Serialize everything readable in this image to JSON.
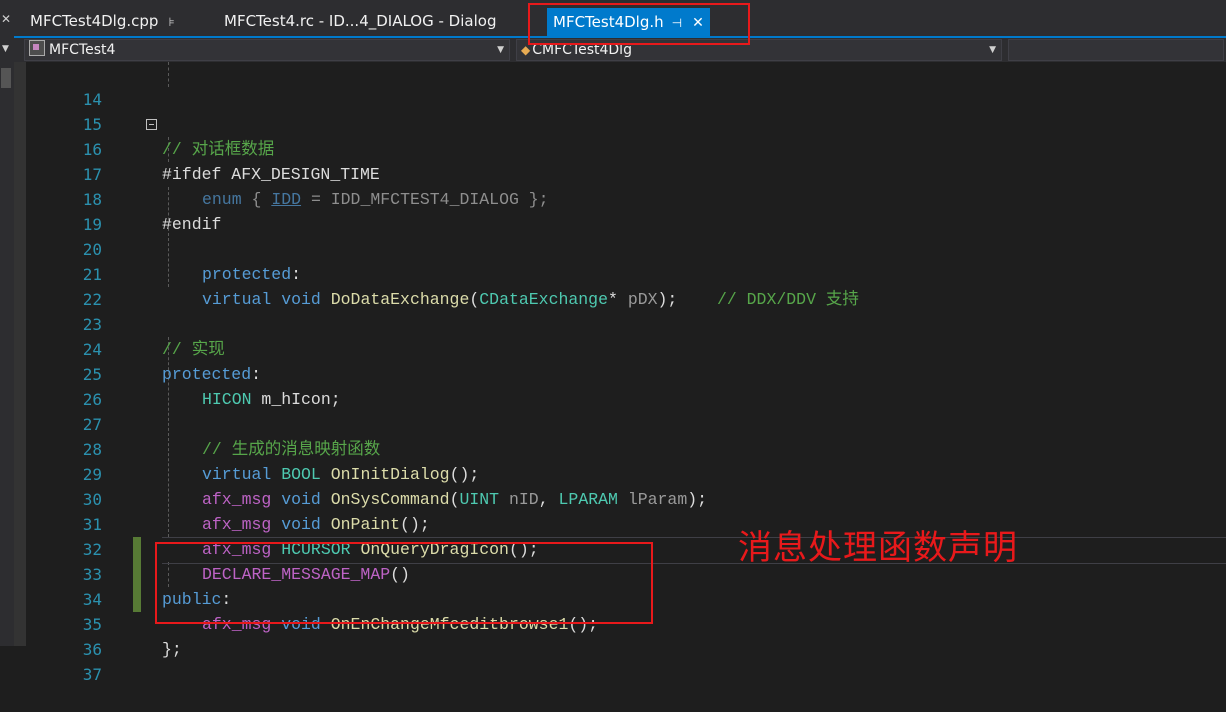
{
  "tabs": [
    {
      "label": "MFCTest4Dlg.cpp",
      "pin": "⊧"
    },
    {
      "label": "MFCTest4.rc - ID...4_DIALOG - Dialog"
    },
    {
      "label": "MFCTest4Dlg.h",
      "pin": "⊣",
      "close": "✕",
      "active": true
    }
  ],
  "nav": {
    "project": "MFCTest4",
    "class": "CMFCTest4Dlg"
  },
  "editor": {
    "lines": [
      {
        "n": "14"
      },
      {
        "n": "15",
        "text": "// 对话框数据"
      },
      {
        "n": "16",
        "text": "#ifdef AFX_DESIGN_TIME"
      },
      {
        "n": "17",
        "a": "enum",
        "b": " { ",
        "c": "IDD",
        "d": " = IDD_MFCTEST4_DIALOG };"
      },
      {
        "n": "18",
        "text": "#endif"
      },
      {
        "n": "19"
      },
      {
        "n": "20",
        "a": "protected",
        "b": ":"
      },
      {
        "n": "21",
        "a": "virtual void ",
        "b": "DoDataExchange",
        "c": "(",
        "d": "CDataExchange",
        "e": "* ",
        "f": "pDX",
        "g": ");",
        "h": "    // DDX/DDV 支持"
      },
      {
        "n": "22"
      },
      {
        "n": "23",
        "text": "// 实现"
      },
      {
        "n": "24",
        "a": "protected",
        "b": ":"
      },
      {
        "n": "25",
        "a": "HICON",
        "b": " m_hIcon;"
      },
      {
        "n": "26"
      },
      {
        "n": "27",
        "text": "// 生成的消息映射函数"
      },
      {
        "n": "28",
        "a": "virtual ",
        "b": "BOOL ",
        "c": "OnInitDialog",
        "d": "();"
      },
      {
        "n": "29",
        "a": "afx_msg",
        "b": " ",
        "c": "void ",
        "d": "OnSysCommand",
        "e": "(",
        "f": "UINT ",
        "g": "nID",
        "h": ", ",
        "i": "LPARAM ",
        "j": "lParam",
        "k": ");"
      },
      {
        "n": "30",
        "a": "afx_msg",
        "b": " ",
        "c": "void ",
        "d": "OnPaint",
        "e": "();"
      },
      {
        "n": "31",
        "a": "afx_msg",
        "b": " ",
        "c": "HCURSOR ",
        "d": "OnQueryDragIcon",
        "e": "();"
      },
      {
        "n": "32",
        "a": "DECLARE_MESSAGE_MAP",
        "b": "()"
      },
      {
        "n": "33",
        "a": "public",
        "b": ":"
      },
      {
        "n": "34",
        "a": "afx_msg",
        "b": " ",
        "c": "void ",
        "d": "OnEnChangeMfceditbrowse1",
        "e": "();"
      },
      {
        "n": "35",
        "text": "};"
      },
      {
        "n": "36"
      },
      {
        "n": "37"
      }
    ]
  },
  "annotation": "消息处理函数声明",
  "colors": {
    "keyword": "#569cd6",
    "comment": "#57a64a",
    "type": "#4ec9b0",
    "function": "#dcdcaa",
    "macro": "#bd63c5",
    "annotation_red": "#e8191b",
    "tab_active": "#007acc"
  }
}
